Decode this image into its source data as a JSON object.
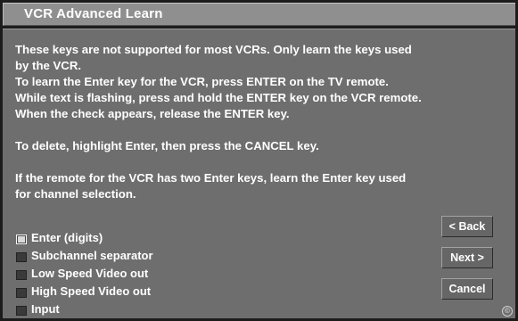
{
  "window": {
    "title": "VCR Advanced Learn"
  },
  "instructions": {
    "line1": "These keys are not supported for most VCRs. Only learn the keys used",
    "line2": "by the VCR.",
    "line3": "To learn the Enter key for the VCR, press ENTER on the TV remote.",
    "line4": "While text is flashing, press and hold the ENTER key on the VCR remote.",
    "line5": "When the check appears, release the ENTER key.",
    "line6": "To delete, highlight Enter, then press the CANCEL key.",
    "line7": "If the remote for the VCR has two Enter keys, learn the Enter key used",
    "line8": "for channel selection."
  },
  "options": [
    {
      "label": "Enter (digits)",
      "selected": true
    },
    {
      "label": "Subchannel separator",
      "selected": false
    },
    {
      "label": "Low Speed Video out",
      "selected": false
    },
    {
      "label": "High Speed Video out",
      "selected": false
    },
    {
      "label": "Input",
      "selected": false
    }
  ],
  "buttons": {
    "back_label": "< Back",
    "next_label": "Next >",
    "cancel_label": "Cancel"
  },
  "corner_mark": "©",
  "colors": {
    "titlebar": "#8f8f8f",
    "panel": "#6e6e6e",
    "text": "#ffffff"
  }
}
